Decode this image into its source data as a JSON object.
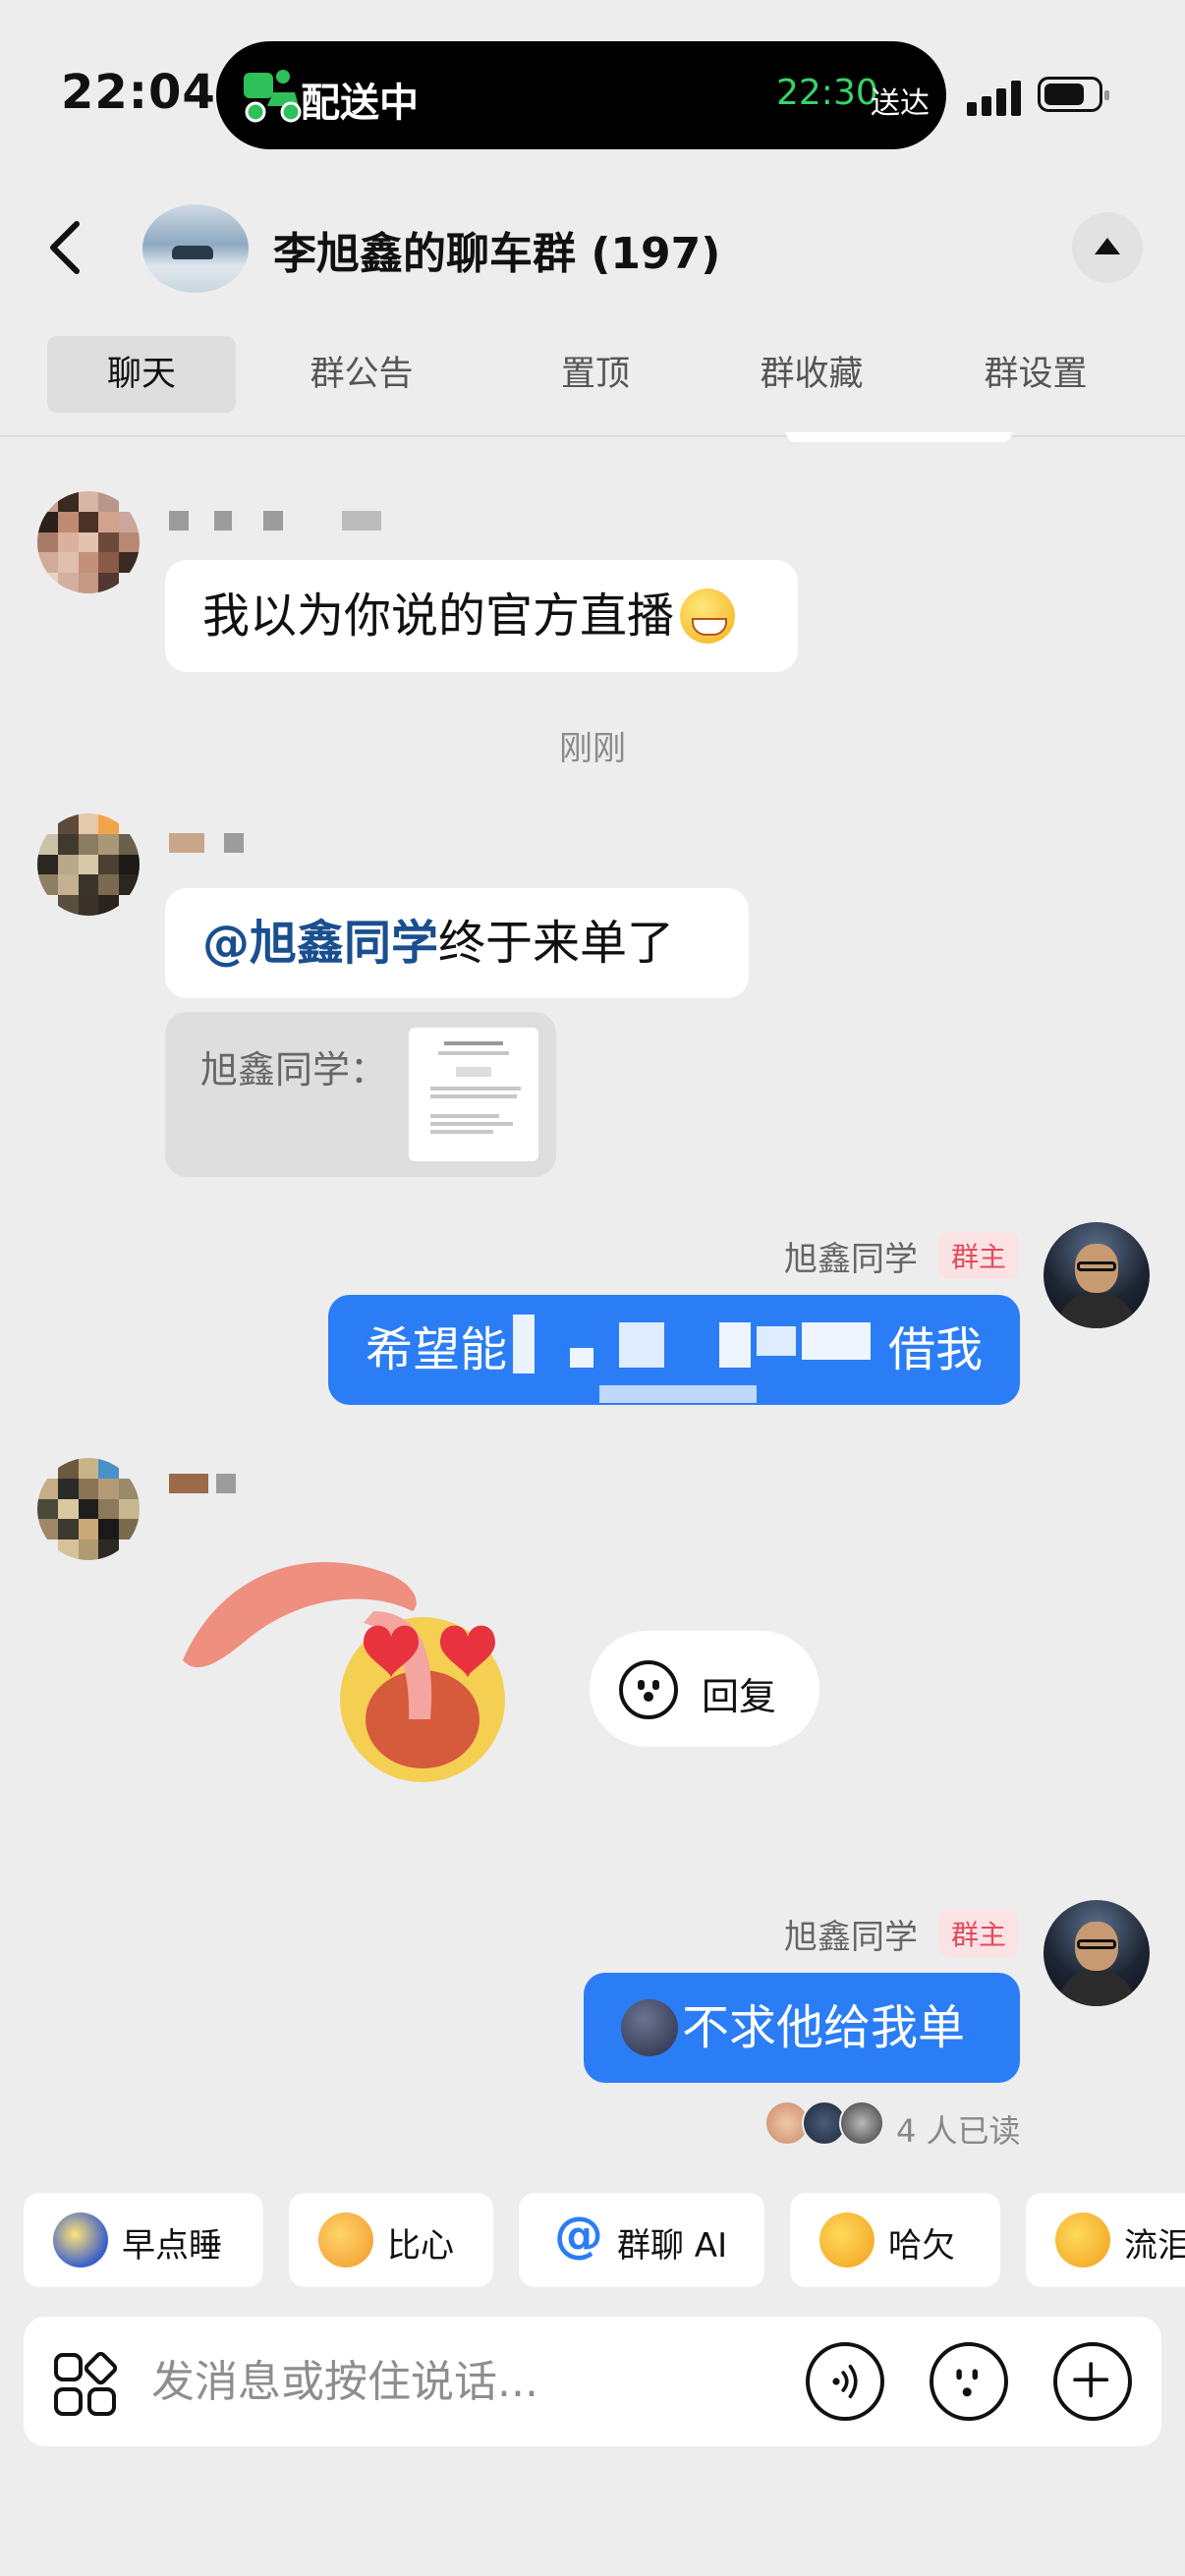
{
  "status": {
    "time": "22:04",
    "delivery": "配送中",
    "eta_time": "22:30",
    "eta_label": "送达"
  },
  "header": {
    "title": "李旭鑫的聊车群 (197)"
  },
  "tabs": [
    "聊天",
    "群公告",
    "置顶",
    "群收藏",
    "群设置"
  ],
  "messages": {
    "m1_text": "我以为你说的官方直播",
    "timestamp": "刚刚",
    "m2_mention": "@旭鑫同学",
    "m2_text": " 终于来单了",
    "m2_quote_label": "旭鑫同学：",
    "m3_sender": "旭鑫同学",
    "m3_badge": "群主",
    "m3_prefix": "希望能",
    "m3_suffix": "借我",
    "reply_label": "回复",
    "m5_sender": "旭鑫同学",
    "m5_badge": "群主",
    "m5_text": "不求他给我单",
    "read_status": "4 人已读"
  },
  "quick_chips": [
    {
      "label": "早点睡",
      "icon": "moon-sleep-icon"
    },
    {
      "label": "比心",
      "icon": "heart-hands-icon"
    },
    {
      "label": "群聊 AI",
      "icon": "at-icon"
    },
    {
      "label": "哈欠",
      "icon": "yawn-icon"
    },
    {
      "label": "流泪",
      "icon": "tears-icon"
    }
  ],
  "input": {
    "placeholder": "发消息或按住说话..."
  },
  "colors": {
    "accent": "#2b7df5",
    "mention": "#1a4f8f",
    "owner_badge": "#e24b5b",
    "eta_green": "#36d46a"
  }
}
